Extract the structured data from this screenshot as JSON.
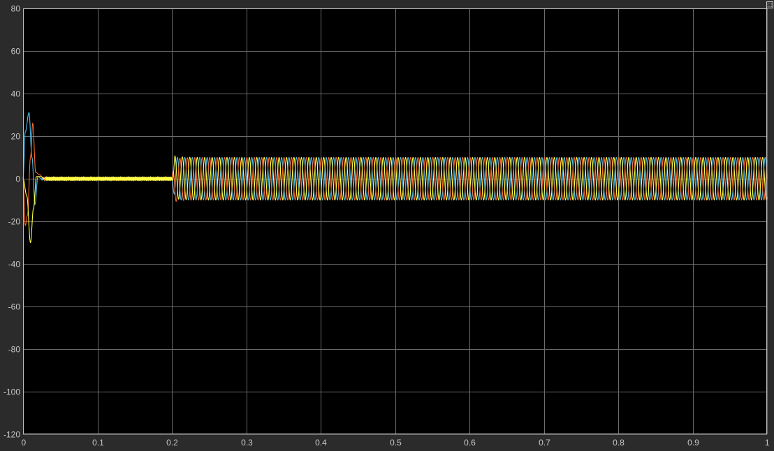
{
  "colors": {
    "figure_background": "#2b2b2b",
    "axes_background": "#000000",
    "grid": "#6b6b6b",
    "axes_border": "#bfbfbf",
    "tick_text": "#c8c8c8",
    "series": [
      "#4DBEEE",
      "#FF6A2C",
      "#FFFF44"
    ]
  },
  "toolbar": {
    "restore_icon": "restore-axes-icon"
  },
  "chart_data": {
    "type": "line",
    "title": "",
    "xlabel": "",
    "ylabel": "",
    "xlim": [
      0,
      1
    ],
    "ylim": [
      -120,
      80
    ],
    "grid": true,
    "legend": "none",
    "x_ticks": [
      0,
      0.1,
      0.2,
      0.3,
      0.4,
      0.5,
      0.6,
      0.7,
      0.8,
      0.9,
      1
    ],
    "x_tick_labels": [
      "0",
      "0.1",
      "0.2",
      "0.3",
      "0.4",
      "0.5",
      "0.6",
      "0.7",
      "0.8",
      "0.9",
      "1"
    ],
    "y_ticks": [
      80,
      60,
      40,
      20,
      0,
      -20,
      -40,
      -60,
      -80,
      -100,
      -120
    ],
    "y_tick_labels": [
      "80",
      "60",
      "40",
      "20",
      "0",
      "-20",
      "-40",
      "-60",
      "-80",
      "-100",
      "-120"
    ],
    "signal": {
      "frequency_hz": 100,
      "phase_count": 3,
      "steady_amplitude": 10,
      "step_time": 0.2,
      "pre_step_ripple_amplitude": 1
    },
    "series": [
      {
        "color": "#4DBEEE",
        "phase_deg": 0,
        "transient_x": [
          0,
          0.003,
          0.008,
          0.012,
          0.016,
          0.02,
          0.025
        ],
        "transient_y": [
          0,
          22,
          31,
          10,
          -12,
          1,
          0
        ]
      },
      {
        "color": "#FF6A2C",
        "phase_deg": -120,
        "transient_x": [
          0,
          0.003,
          0.006,
          0.01,
          0.013,
          0.017,
          0.022,
          0.028
        ],
        "transient_y": [
          0,
          -22,
          -17,
          10,
          26,
          3,
          2,
          0
        ]
      },
      {
        "color": "#FFFF44",
        "phase_deg": 120,
        "transient_x": [
          0,
          0.005,
          0.01,
          0.014,
          0.018,
          0.023,
          0.03
        ],
        "transient_y": [
          0,
          -8,
          -30,
          -14,
          1,
          1,
          0
        ]
      }
    ]
  }
}
